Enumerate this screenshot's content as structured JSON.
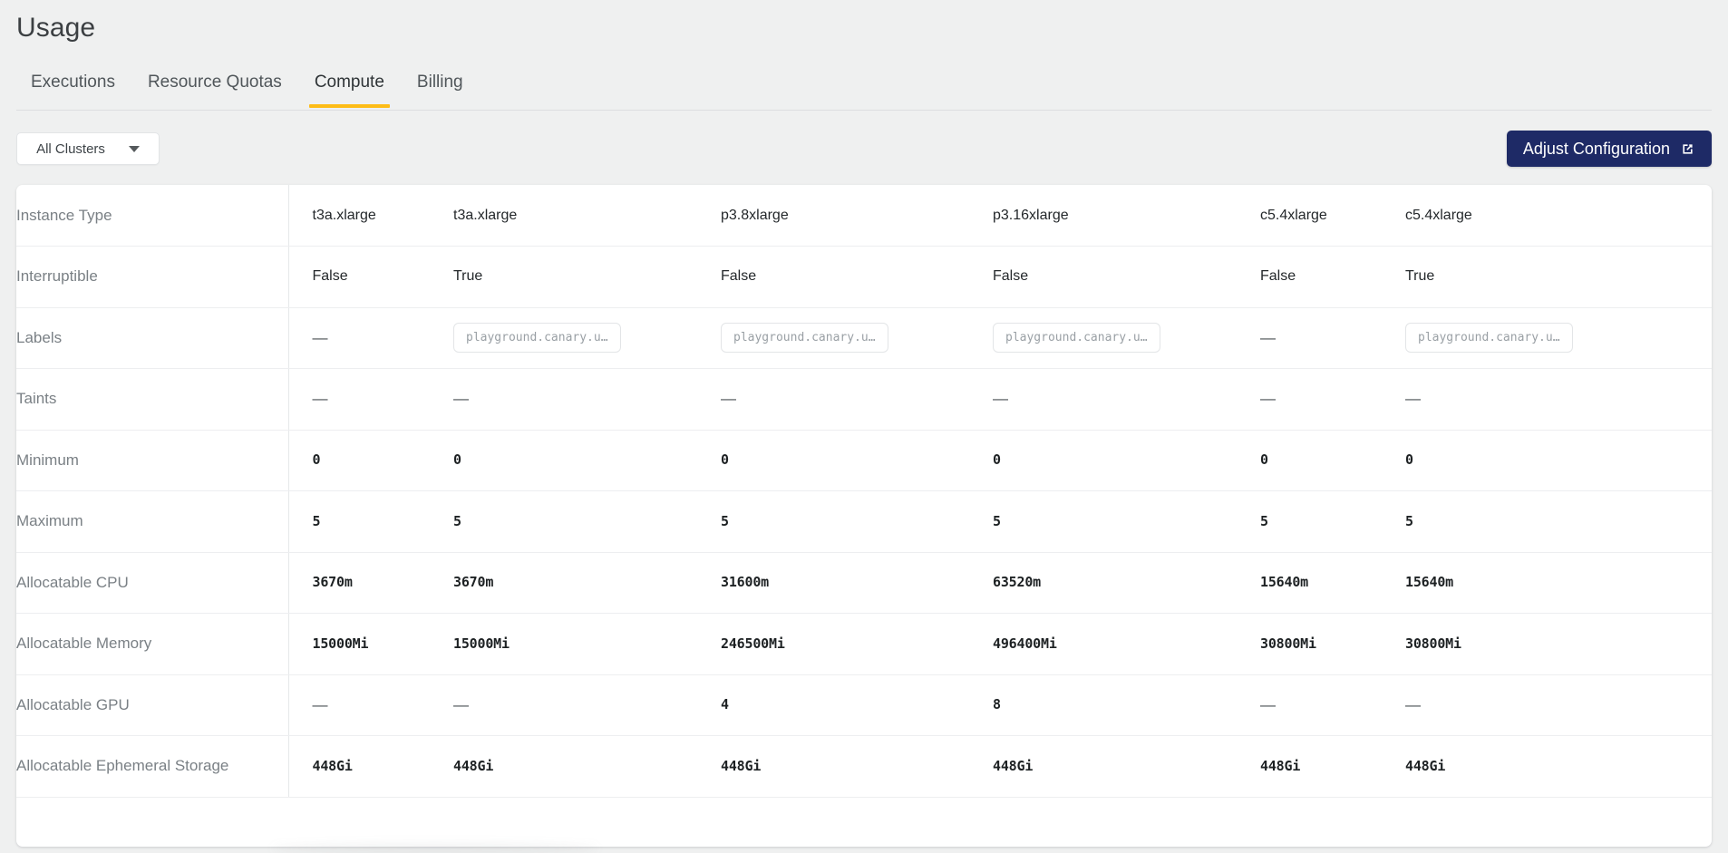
{
  "header": {
    "title": "Usage"
  },
  "tabs": [
    {
      "label": "Executions",
      "active": false
    },
    {
      "label": "Resource Quotas",
      "active": false
    },
    {
      "label": "Compute",
      "active": true
    },
    {
      "label": "Billing",
      "active": false
    }
  ],
  "toolbar": {
    "cluster_filter_value": "All Clusters",
    "cluster_filter_icon": "chevron-down-icon",
    "adjust_button_label": "Adjust Configuration",
    "adjust_button_icon": "external-link-icon"
  },
  "colors": {
    "page_background": "#EFF0F0",
    "card_background": "#FFFFFF",
    "tab_active_underline": "#FDBC17",
    "primary_button": "#1E2A66",
    "row_label_text": "#7A8085",
    "value_text": "#24282B",
    "chip_border": "#E3E5E7",
    "chip_text": "#9AA0A5"
  },
  "table": {
    "row_labels": [
      "Instance Type",
      "Interruptible",
      "Labels",
      "Taints",
      "Minimum",
      "Maximum",
      "Allocatable CPU",
      "Allocatable Memory",
      "Allocatable GPU",
      "Allocatable Ephemeral Storage"
    ],
    "columns": [
      {
        "instance_type": "t3a.xlarge",
        "interruptible": "False",
        "labels": "—",
        "labels_is_chip": false,
        "taints": "—",
        "minimum": "0",
        "maximum": "5",
        "allocatable_cpu": "3670m",
        "allocatable_memory": "15000Mi",
        "allocatable_gpu": "—",
        "allocatable_ephemeral_storage": "448Gi"
      },
      {
        "instance_type": "t3a.xlarge",
        "interruptible": "True",
        "labels": "playground.canary.u…",
        "labels_is_chip": true,
        "taints": "—",
        "minimum": "0",
        "maximum": "5",
        "allocatable_cpu": "3670m",
        "allocatable_memory": "15000Mi",
        "allocatable_gpu": "—",
        "allocatable_ephemeral_storage": "448Gi"
      },
      {
        "instance_type": "p3.8xlarge",
        "interruptible": "False",
        "labels": "playground.canary.u…",
        "labels_is_chip": true,
        "taints": "—",
        "minimum": "0",
        "maximum": "5",
        "allocatable_cpu": "31600m",
        "allocatable_memory": "246500Mi",
        "allocatable_gpu": "4",
        "allocatable_ephemeral_storage": "448Gi"
      },
      {
        "instance_type": "p3.16xlarge",
        "interruptible": "False",
        "labels": "playground.canary.u…",
        "labels_is_chip": true,
        "taints": "—",
        "minimum": "0",
        "maximum": "5",
        "allocatable_cpu": "63520m",
        "allocatable_memory": "496400Mi",
        "allocatable_gpu": "8",
        "allocatable_ephemeral_storage": "448Gi"
      },
      {
        "instance_type": "c5.4xlarge",
        "interruptible": "False",
        "labels": "—",
        "labels_is_chip": false,
        "taints": "—",
        "minimum": "0",
        "maximum": "5",
        "allocatable_cpu": "15640m",
        "allocatable_memory": "30800Mi",
        "allocatable_gpu": "—",
        "allocatable_ephemeral_storage": "448Gi"
      },
      {
        "instance_type": "c5.4xlarge",
        "interruptible": "True",
        "labels": "playground.canary.u…",
        "labels_is_chip": true,
        "taints": "—",
        "minimum": "0",
        "maximum": "5",
        "allocatable_cpu": "15640m",
        "allocatable_memory": "30800Mi",
        "allocatable_gpu": "—",
        "allocatable_ephemeral_storage": "448Gi"
      }
    ]
  }
}
